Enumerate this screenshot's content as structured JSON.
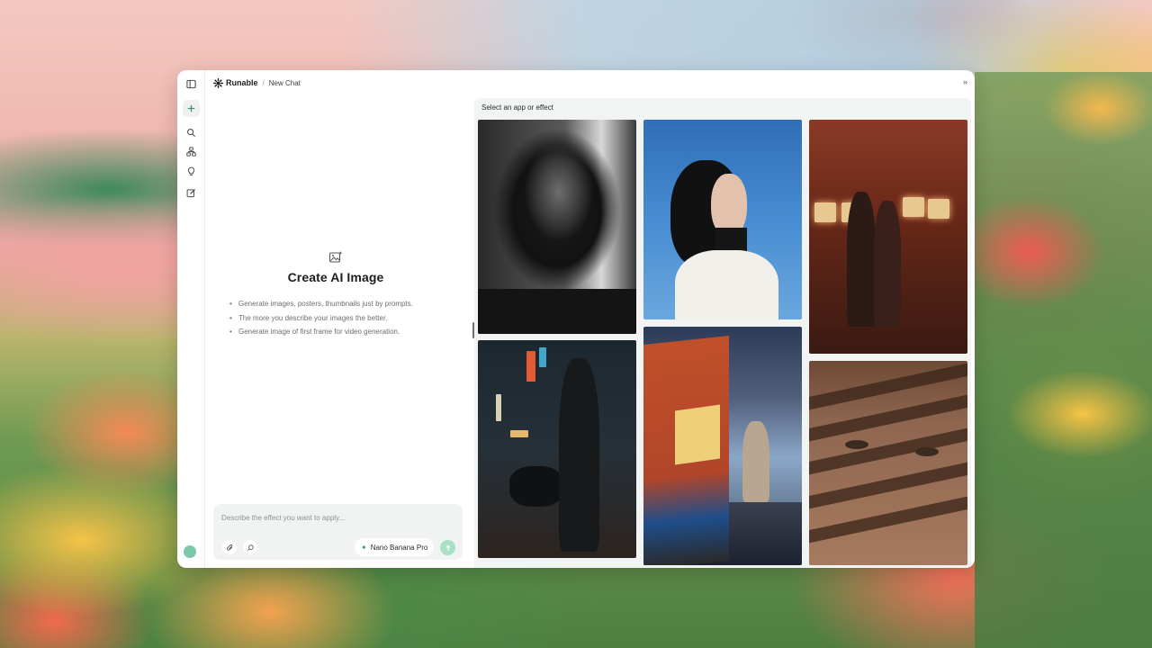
{
  "app": {
    "brand": "Runable",
    "breadcrumb_sep": "/",
    "breadcrumb": "New Chat"
  },
  "sidebar": {
    "items": [
      {
        "name": "toggle-sidebar",
        "icon": "sidebar-icon"
      },
      {
        "name": "new-chat",
        "icon": "plus-icon"
      },
      {
        "name": "search",
        "icon": "search-icon"
      },
      {
        "name": "workflows",
        "icon": "nodes-icon"
      },
      {
        "name": "ideas",
        "icon": "lightbulb-icon"
      },
      {
        "name": "edit",
        "icon": "edit-icon"
      }
    ]
  },
  "main": {
    "title": "Create AI Image",
    "tips": [
      "Generate images, posters, thumbnails just by prompts.",
      "The more you describe your images the better.",
      "Generate image of first frame for video generation."
    ]
  },
  "composer": {
    "placeholder": "Describe the effect you want to apply...",
    "model": "Nano Banana Pro"
  },
  "panel": {
    "title": "Select an app or effect",
    "items": [
      {
        "name": "bw-portrait"
      },
      {
        "name": "blue-sky-portrait"
      },
      {
        "name": "arcade-couple"
      },
      {
        "name": "neon-street-biker"
      },
      {
        "name": "subway-train-woman"
      },
      {
        "name": "shadow-stripes-face"
      }
    ]
  },
  "colors": {
    "accent": "#3b8f73",
    "send_button": "#a9dfc7",
    "panel_bg": "#f2f3f3"
  }
}
